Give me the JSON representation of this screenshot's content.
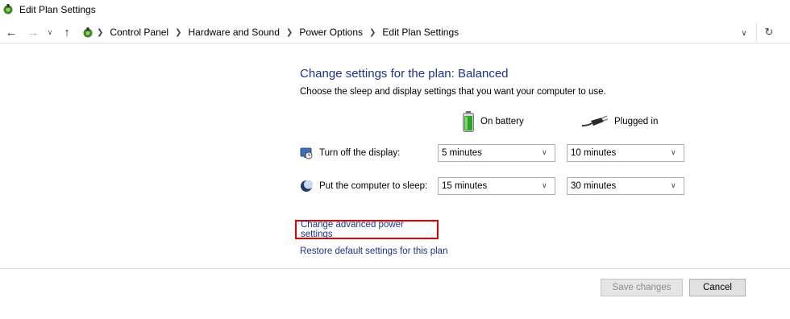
{
  "window": {
    "title": "Edit Plan Settings"
  },
  "address_bar": {
    "breadcrumbs": [
      "Control Panel",
      "Hardware and Sound",
      "Power Options",
      "Edit Plan Settings"
    ]
  },
  "content": {
    "heading": "Change settings for the plan: Balanced",
    "subheading": "Choose the sleep and display settings that you want your computer to use.",
    "columns": {
      "battery": "On battery",
      "plugged": "Plugged in"
    },
    "rows": [
      {
        "label": "Turn off the display:",
        "battery_value": "5 minutes",
        "plugged_value": "10 minutes"
      },
      {
        "label": "Put the computer to sleep:",
        "battery_value": "15 minutes",
        "plugged_value": "30 minutes"
      }
    ],
    "links": {
      "advanced": "Change advanced power settings",
      "restore": "Restore default settings for this plan"
    }
  },
  "buttons": {
    "save": "Save changes",
    "cancel": "Cancel"
  },
  "colors": {
    "link": "#1e3287",
    "highlight_box": "#e00000"
  }
}
